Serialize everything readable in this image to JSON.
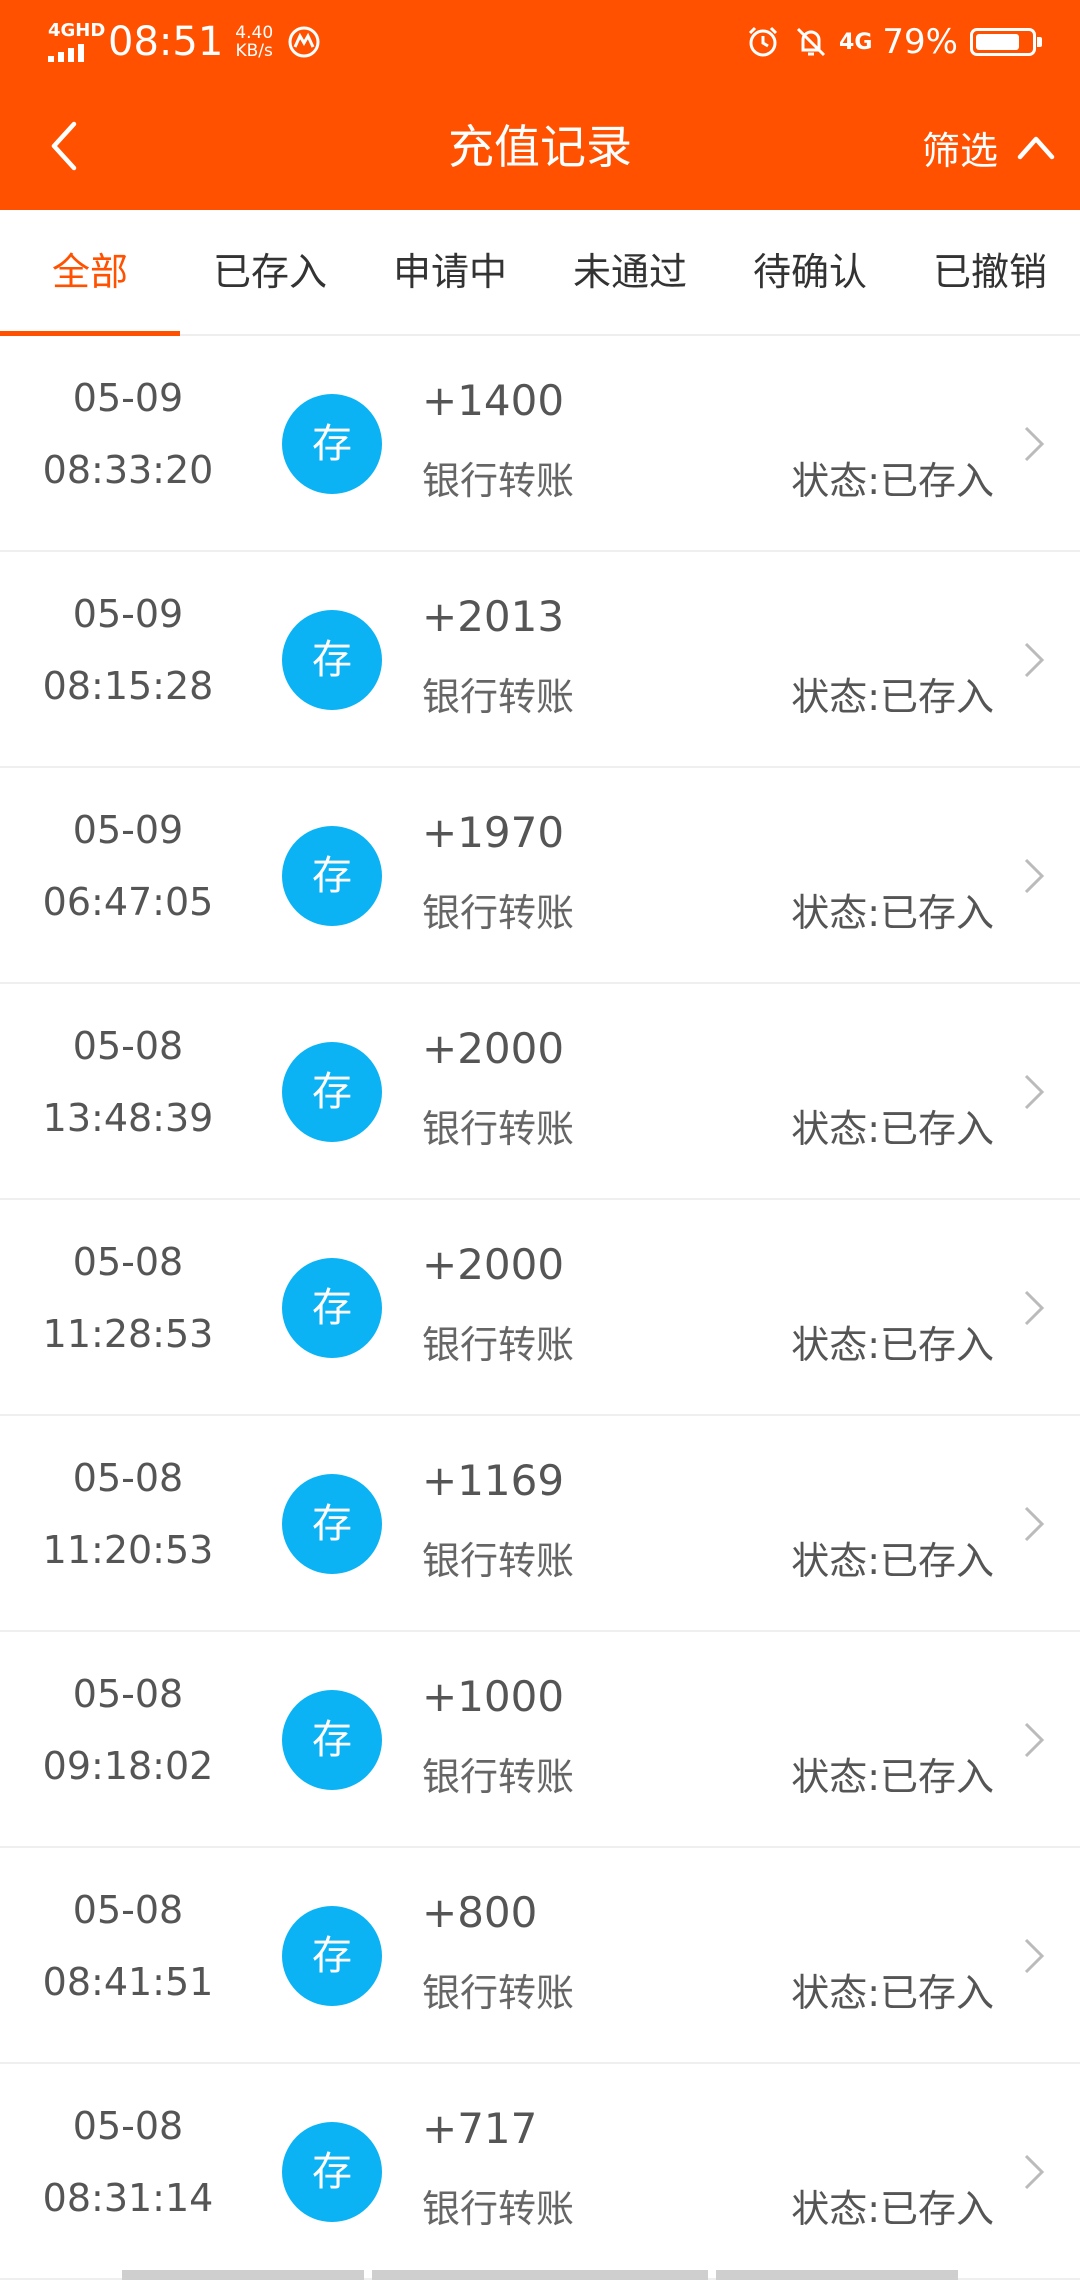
{
  "status_bar": {
    "network_label": "4GHD",
    "time": "08:51",
    "speed_value": "4.40",
    "speed_unit": "KB/s",
    "mobile_label": "4G",
    "battery_percent": "79%",
    "battery_level": 0.79
  },
  "header": {
    "title": "充值记录",
    "filter_label": "筛选",
    "color": "#ff5100"
  },
  "tabs": [
    {
      "label": "全部",
      "active": true
    },
    {
      "label": "已存入",
      "active": false
    },
    {
      "label": "申请中",
      "active": false
    },
    {
      "label": "未通过",
      "active": false
    },
    {
      "label": "待确认",
      "active": false
    },
    {
      "label": "已撤销",
      "active": false
    }
  ],
  "records": [
    {
      "date": "05-09",
      "time": "08:33:20",
      "badge": "存",
      "amount": "+1400",
      "method": "银行转账",
      "status": "状态:已存入"
    },
    {
      "date": "05-09",
      "time": "08:15:28",
      "badge": "存",
      "amount": "+2013",
      "method": "银行转账",
      "status": "状态:已存入"
    },
    {
      "date": "05-09",
      "time": "06:47:05",
      "badge": "存",
      "amount": "+1970",
      "method": "银行转账",
      "status": "状态:已存入"
    },
    {
      "date": "05-08",
      "time": "13:48:39",
      "badge": "存",
      "amount": "+2000",
      "method": "银行转账",
      "status": "状态:已存入"
    },
    {
      "date": "05-08",
      "time": "11:28:53",
      "badge": "存",
      "amount": "+2000",
      "method": "银行转账",
      "status": "状态:已存入"
    },
    {
      "date": "05-08",
      "time": "11:20:53",
      "badge": "存",
      "amount": "+1169",
      "method": "银行转账",
      "status": "状态:已存入"
    },
    {
      "date": "05-08",
      "time": "09:18:02",
      "badge": "存",
      "amount": "+1000",
      "method": "银行转账",
      "status": "状态:已存入"
    },
    {
      "date": "05-08",
      "time": "08:41:51",
      "badge": "存",
      "amount": "+800",
      "method": "银行转账",
      "status": "状态:已存入"
    },
    {
      "date": "05-08",
      "time": "08:31:14",
      "badge": "存",
      "amount": "+717",
      "method": "银行转账",
      "status": "状态:已存入"
    }
  ],
  "colors": {
    "accent": "#ff5100",
    "badge": "#0bb3f5"
  }
}
